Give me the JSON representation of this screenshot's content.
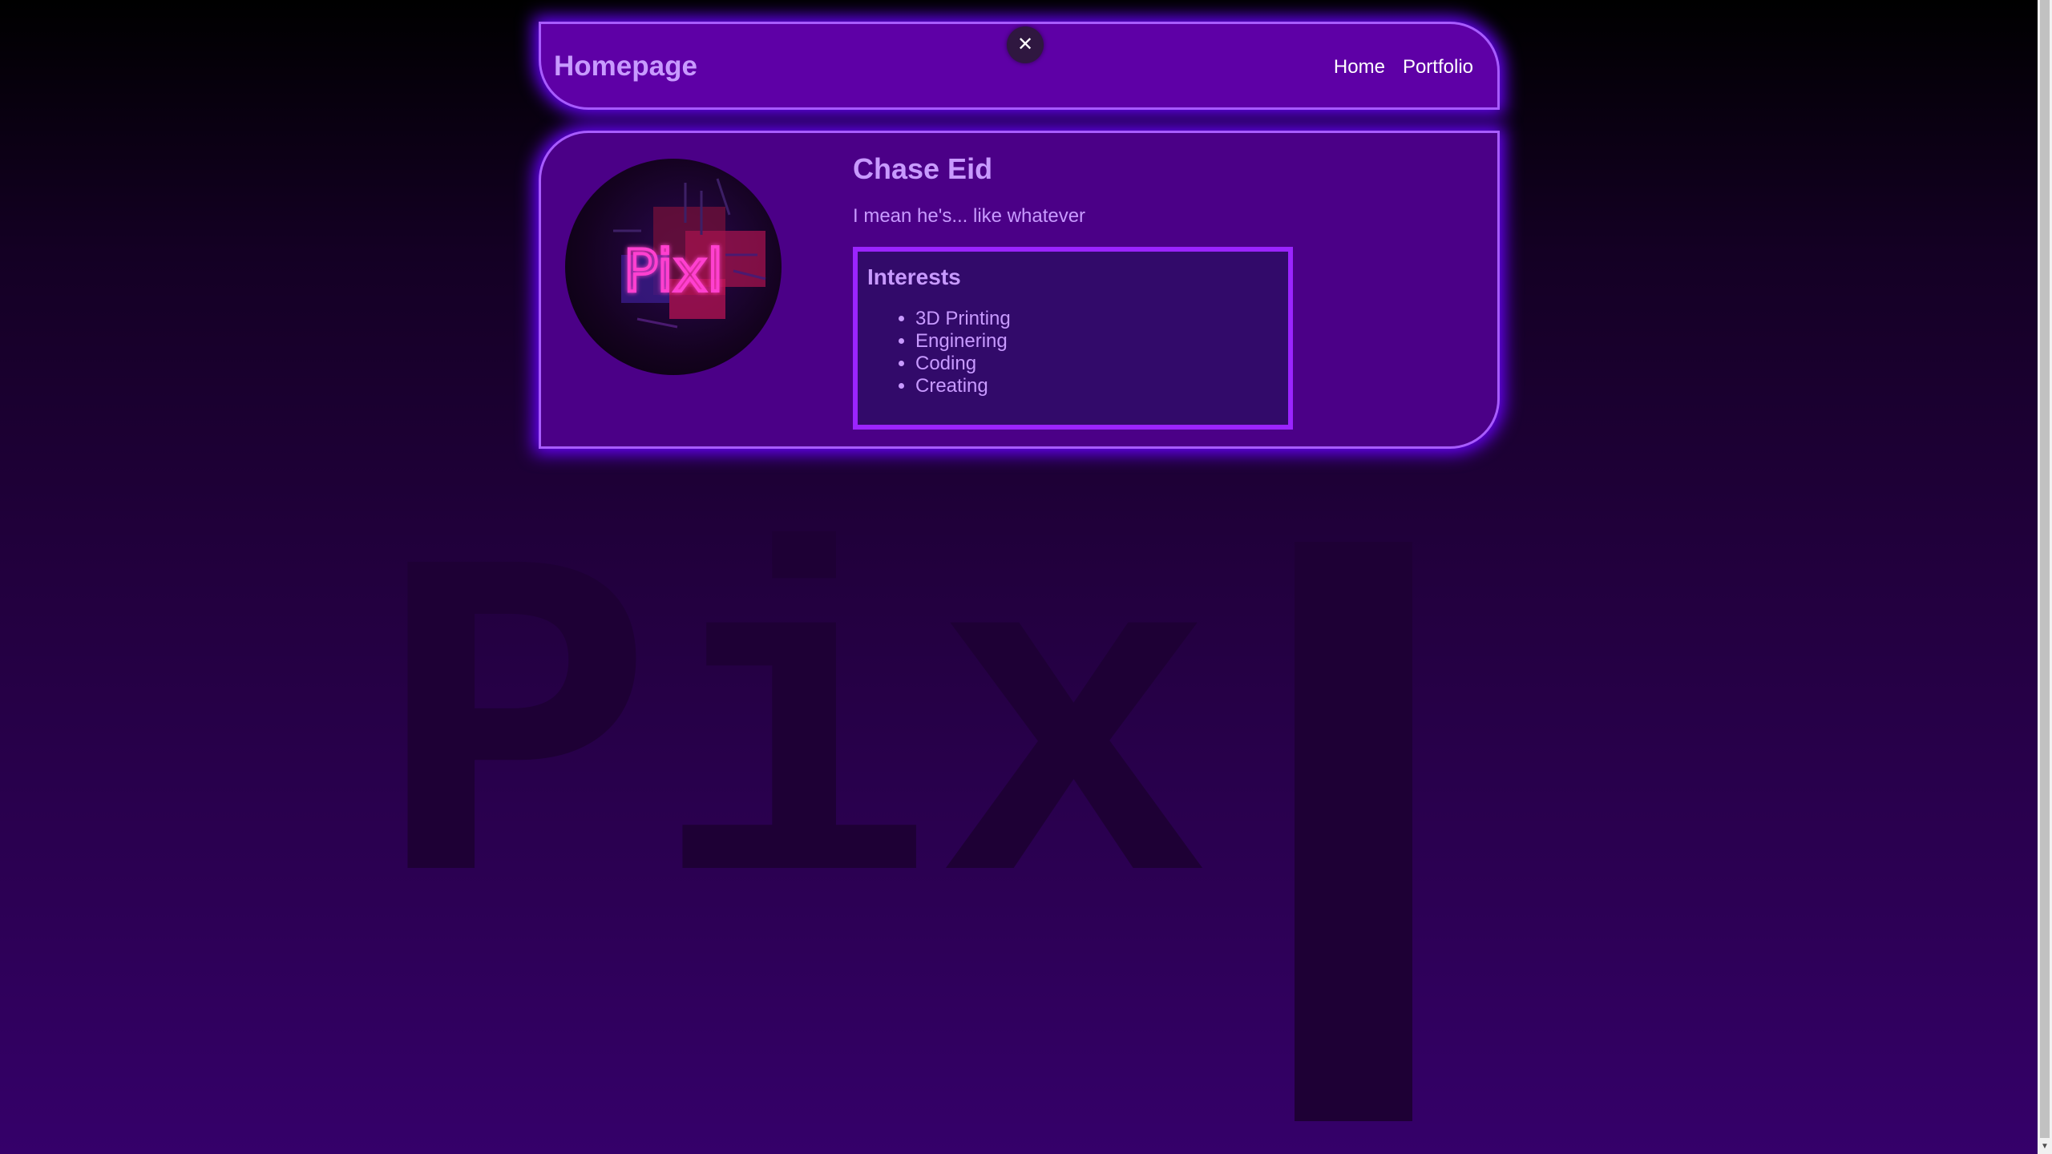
{
  "header": {
    "title": "Homepage",
    "nav": [
      "Home",
      "Portfolio"
    ],
    "close_symbol": "✕"
  },
  "profile": {
    "name": "Chase Eid",
    "tagline": "I mean he's... like whatever",
    "avatar_text": "Pixl"
  },
  "interests": {
    "heading": "Interests",
    "items": [
      "3D Printing",
      "Enginering",
      "Coding",
      "Creating"
    ]
  },
  "background": {
    "word": "Pix"
  },
  "colors": {
    "accent": "#a85cff",
    "header_bg": "#5e00a6",
    "card_bg": "#4b0087",
    "interests_border": "#9b24ff",
    "text": "#c89aff"
  }
}
